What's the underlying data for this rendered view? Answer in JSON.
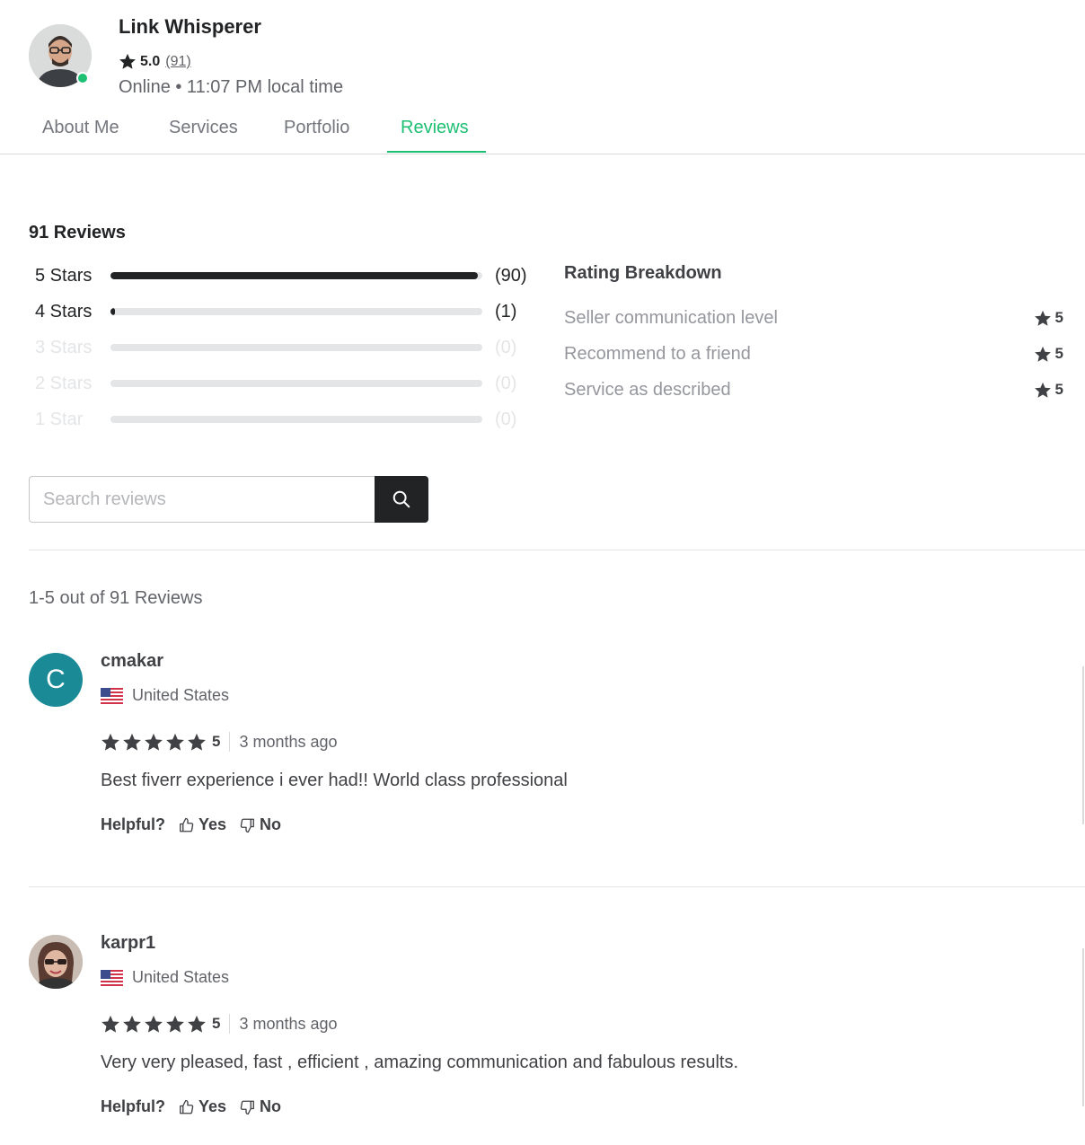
{
  "seller": {
    "name": "Link Whisperer",
    "rating": "5.0",
    "rating_count": "(91)",
    "status": "Online • 11:07 PM local time",
    "online_color": "#1dbf73"
  },
  "tabs": [
    {
      "label": "About Me"
    },
    {
      "label": "Services"
    },
    {
      "label": "Portfolio"
    },
    {
      "label": "Reviews",
      "active": true
    }
  ],
  "summary": {
    "total_label": "91 Reviews",
    "star_rows": [
      {
        "label": "5 Stars",
        "count_label": "(90)",
        "count": 90,
        "fraction": 0.989
      },
      {
        "label": "4 Stars",
        "count_label": "(1)",
        "count": 1,
        "fraction": 0.011
      },
      {
        "label": "3 Stars",
        "count_label": "(0)",
        "count": 0,
        "fraction": 0
      },
      {
        "label": "2 Stars",
        "count_label": "(0)",
        "count": 0,
        "fraction": 0
      },
      {
        "label": "1 Star",
        "count_label": "(0)",
        "count": 0,
        "fraction": 0
      }
    ],
    "breakdown_title": "Rating Breakdown",
    "breakdown": [
      {
        "name": "Seller communication level",
        "value": "5"
      },
      {
        "name": "Recommend to a friend",
        "value": "5"
      },
      {
        "name": "Service as described",
        "value": "5"
      }
    ]
  },
  "search": {
    "placeholder": "Search reviews",
    "icon": "search-icon"
  },
  "results_label": "1-5 out of 91 Reviews",
  "reviews": [
    {
      "initial": "C",
      "avatar_color": "#1a8a96",
      "username": "cmakar",
      "country": "United States",
      "stars": 5,
      "score": "5",
      "time": "3 months ago",
      "text": "Best fiverr experience i ever had!! World class professional",
      "helpful_label": "Helpful?",
      "yes_label": "Yes",
      "no_label": "No"
    },
    {
      "initial": "",
      "avatar_color": "#b7a89c",
      "username": "karpr1",
      "country": "United States",
      "stars": 5,
      "score": "5",
      "time": "3 months ago",
      "text": "Very very pleased, fast , efficient , amazing communication and fabulous results.",
      "helpful_label": "Helpful?",
      "yes_label": "Yes",
      "no_label": "No"
    }
  ],
  "colors": {
    "accent": "#1dbf73",
    "dark": "#222325",
    "muted": "#62646a"
  }
}
